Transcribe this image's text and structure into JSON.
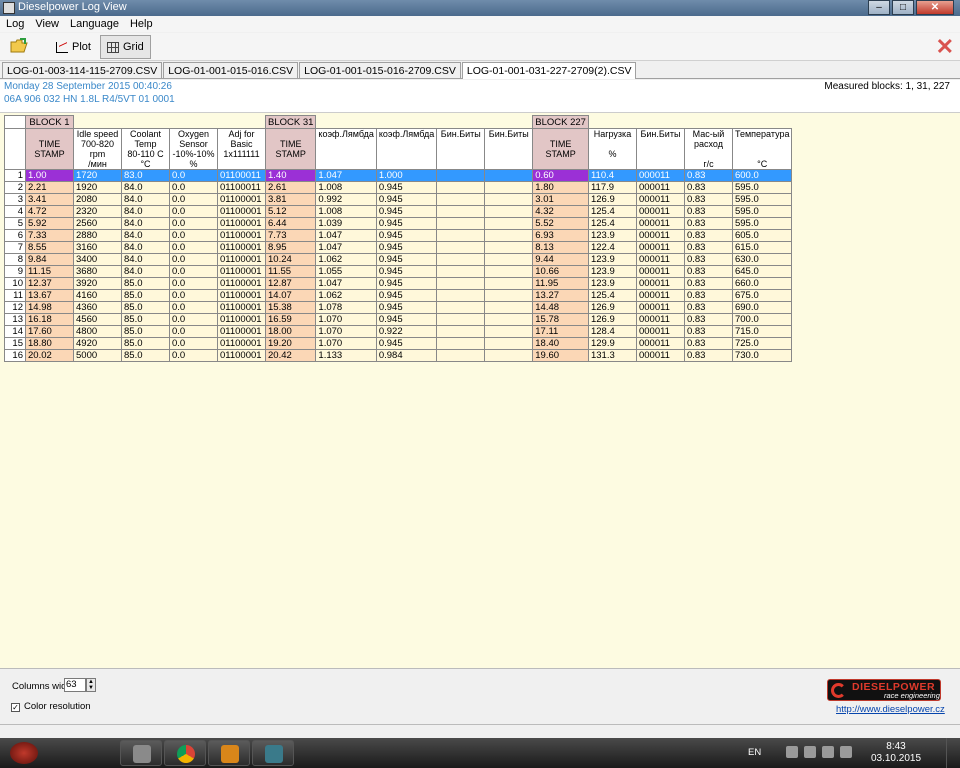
{
  "window": {
    "title": "Dieselpower Log View"
  },
  "menu": [
    "Log",
    "View",
    "Language",
    "Help"
  ],
  "toolbar": {
    "plot_label": "Plot",
    "grid_label": "Grid"
  },
  "tabs": [
    "LOG-01-003-114-115-2709.CSV",
    "LOG-01-001-015-016.CSV",
    "LOG-01-001-015-016-2709.CSV",
    "LOG-01-001-031-227-2709(2).CSV"
  ],
  "info": {
    "date": "Monday 28 September 2015 00:40:26",
    "ecu": "06A 906 032 HN  1.8L R4/5VT      01 0001",
    "measured_blocks": "Measured blocks: 1, 31, 227"
  },
  "grid": {
    "blocks": [
      "BLOCK 1",
      "BLOCK 31",
      "BLOCK 227"
    ],
    "headers": [
      "TIME\nSTAMP",
      "Idle speed\n700-820 rpm\n/мин",
      "Coolant\nTemp\n80-110 C\n°C",
      "Oxygen\nSensor\n-10%-10%\n%",
      "Adj for Basic\n1x111111",
      "TIME\nSTAMP",
      "коэф.Лямбда",
      "коэф.Лямбда",
      "Бин.Биты",
      "Бин.Биты",
      "TIME\nSTAMP",
      "Нагрузка\n\n%",
      "Бин.Биты",
      "Мас-ый\nрасход\n\nг/с",
      "Температура\n\n\n°C"
    ],
    "rows": [
      [
        "1.00",
        "1720",
        "83.0",
        "0.0",
        "01100011",
        "1.40",
        "1.047",
        "1.000",
        "",
        "",
        "0.60",
        "110.4",
        "000011",
        "0.83",
        "600.0"
      ],
      [
        "2.21",
        "1920",
        "84.0",
        "0.0",
        "01100011",
        "2.61",
        "1.008",
        "0.945",
        "",
        "",
        "1.80",
        "117.9",
        "000011",
        "0.83",
        "595.0"
      ],
      [
        "3.41",
        "2080",
        "84.0",
        "0.0",
        "01100001",
        "3.81",
        "0.992",
        "0.945",
        "",
        "",
        "3.01",
        "126.9",
        "000011",
        "0.83",
        "595.0"
      ],
      [
        "4.72",
        "2320",
        "84.0",
        "0.0",
        "01100001",
        "5.12",
        "1.008",
        "0.945",
        "",
        "",
        "4.32",
        "125.4",
        "000011",
        "0.83",
        "595.0"
      ],
      [
        "5.92",
        "2560",
        "84.0",
        "0.0",
        "01100001",
        "6.44",
        "1.039",
        "0.945",
        "",
        "",
        "5.52",
        "125.4",
        "000011",
        "0.83",
        "595.0"
      ],
      [
        "7.33",
        "2880",
        "84.0",
        "0.0",
        "01100001",
        "7.73",
        "1.047",
        "0.945",
        "",
        "",
        "6.93",
        "123.9",
        "000011",
        "0.83",
        "605.0"
      ],
      [
        "8.55",
        "3160",
        "84.0",
        "0.0",
        "01100001",
        "8.95",
        "1.047",
        "0.945",
        "",
        "",
        "8.13",
        "122.4",
        "000011",
        "0.83",
        "615.0"
      ],
      [
        "9.84",
        "3400",
        "84.0",
        "0.0",
        "01100001",
        "10.24",
        "1.062",
        "0.945",
        "",
        "",
        "9.44",
        "123.9",
        "000011",
        "0.83",
        "630.0"
      ],
      [
        "11.15",
        "3680",
        "84.0",
        "0.0",
        "01100001",
        "11.55",
        "1.055",
        "0.945",
        "",
        "",
        "10.66",
        "123.9",
        "000011",
        "0.83",
        "645.0"
      ],
      [
        "12.37",
        "3920",
        "85.0",
        "0.0",
        "01100001",
        "12.87",
        "1.047",
        "0.945",
        "",
        "",
        "11.95",
        "123.9",
        "000011",
        "0.83",
        "660.0"
      ],
      [
        "13.67",
        "4160",
        "85.0",
        "0.0",
        "01100001",
        "14.07",
        "1.062",
        "0.945",
        "",
        "",
        "13.27",
        "125.4",
        "000011",
        "0.83",
        "675.0"
      ],
      [
        "14.98",
        "4360",
        "85.0",
        "0.0",
        "01100001",
        "15.38",
        "1.078",
        "0.945",
        "",
        "",
        "14.48",
        "126.9",
        "000011",
        "0.83",
        "690.0"
      ],
      [
        "16.18",
        "4560",
        "85.0",
        "0.0",
        "01100001",
        "16.59",
        "1.070",
        "0.945",
        "",
        "",
        "15.78",
        "126.9",
        "000011",
        "0.83",
        "700.0"
      ],
      [
        "17.60",
        "4800",
        "85.0",
        "0.0",
        "01100001",
        "18.00",
        "1.070",
        "0.922",
        "",
        "",
        "17.11",
        "128.4",
        "000011",
        "0.83",
        "715.0"
      ],
      [
        "18.80",
        "4920",
        "85.0",
        "0.0",
        "01100001",
        "19.20",
        "1.070",
        "0.945",
        "",
        "",
        "18.40",
        "129.9",
        "000011",
        "0.83",
        "725.0"
      ],
      [
        "20.02",
        "5000",
        "85.0",
        "0.0",
        "01100001",
        "20.42",
        "1.133",
        "0.984",
        "",
        "",
        "19.60",
        "131.3",
        "000011",
        "0.83",
        "730.0"
      ]
    ]
  },
  "bottom": {
    "columns_width_label": "Columns width:",
    "columns_width_value": "63",
    "color_resolution_label": "Color resolution",
    "color_resolution_checked": true,
    "logo_text": "DIESELPOWER",
    "logo_sub": "race engineering",
    "link": "http://www.dieselpower.cz"
  },
  "taskbar": {
    "language": "EN",
    "time": "8:43",
    "date": "03.10.2015"
  },
  "colors": {
    "timestamp_header": "#e2c6c6",
    "timestamp_cell": "#fbd7b6",
    "data_cell": "#fff8da",
    "selection": "#3399ff",
    "selection_timestamp": "#9b30d6",
    "info_text": "#3a88c9",
    "close_x": "#d9534f"
  }
}
